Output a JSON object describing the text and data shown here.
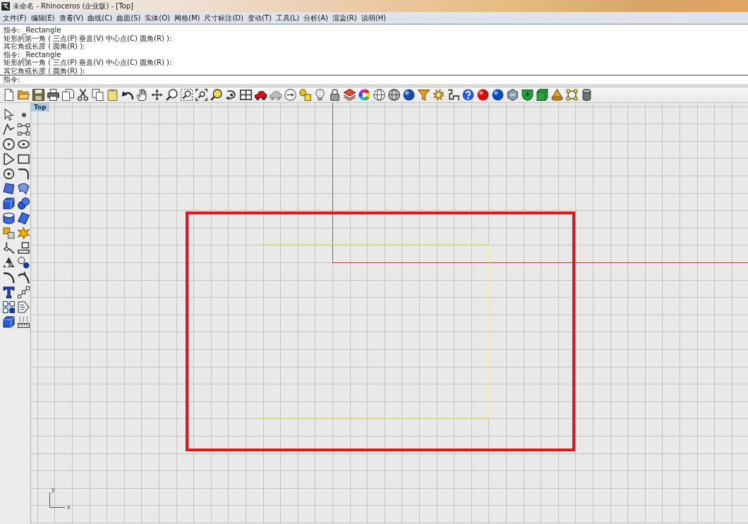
{
  "window": {
    "title": "未命名 - Rhinoceros (企业版) - [Top]"
  },
  "menu": [
    "文件(F)",
    "编辑(E)",
    "查看(V)",
    "曲线(C)",
    "曲面(S)",
    "实体(O)",
    "网格(M)",
    "尺寸标注(D)",
    "变动(T)",
    "工具(L)",
    "分析(A)",
    "渲染(R)",
    "说明(H)"
  ],
  "command_history": [
    "指令: _Rectangle",
    "矩形的第一角 ( 三点(P) 垂直(V) 中心点(C) 圆角(R) ):",
    "其它角或长度 ( 圆角(R) ):",
    "指令: _Rectangle",
    "矩形的第一角 ( 三点(P) 垂直(V) 中心点(C) 圆角(R) ):",
    "其它角或长度 ( 圆角(R) ):"
  ],
  "command_prompt": {
    "label": "指令:"
  },
  "viewport": {
    "title": "Top",
    "axis_labels": {
      "y": "y",
      "x": "x"
    }
  }
}
